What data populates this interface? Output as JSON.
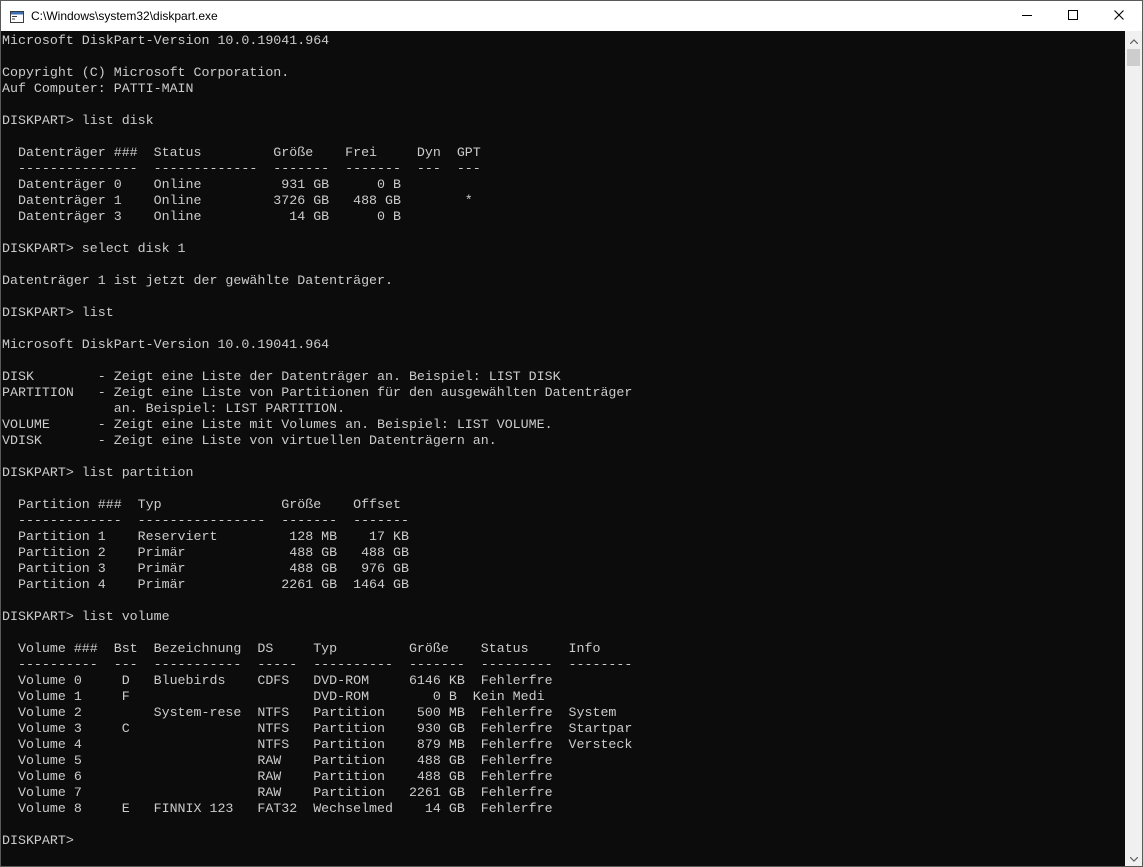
{
  "window": {
    "title": "C:\\Windows\\system32\\diskpart.exe"
  },
  "console": {
    "lines": [
      "Microsoft DiskPart-Version 10.0.19041.964",
      "",
      "Copyright (C) Microsoft Corporation.",
      "Auf Computer: PATTI-MAIN",
      "",
      "DISKPART> list disk",
      "",
      "  Datenträger ###  Status         Größe    Frei     Dyn  GPT",
      "  ---------------  -------------  -------  -------  ---  ---",
      "  Datenträger 0    Online          931 GB      0 B",
      "  Datenträger 1    Online         3726 GB   488 GB        *",
      "  Datenträger 3    Online           14 GB      0 B",
      "",
      "DISKPART> select disk 1",
      "",
      "Datenträger 1 ist jetzt der gewählte Datenträger.",
      "",
      "DISKPART> list",
      "",
      "Microsoft DiskPart-Version 10.0.19041.964",
      "",
      "DISK        - Zeigt eine Liste der Datenträger an. Beispiel: LIST DISK",
      "PARTITION   - Zeigt eine Liste von Partitionen für den ausgewählten Datenträger",
      "              an. Beispiel: LIST PARTITION.",
      "VOLUME      - Zeigt eine Liste mit Volumes an. Beispiel: LIST VOLUME.",
      "VDISK       - Zeigt eine Liste von virtuellen Datenträgern an.",
      "",
      "DISKPART> list partition",
      "",
      "  Partition ###  Typ               Größe    Offset",
      "  -------------  ----------------  -------  -------",
      "  Partition 1    Reserviert         128 MB    17 KB",
      "  Partition 2    Primär             488 GB   488 GB",
      "  Partition 3    Primär             488 GB   976 GB",
      "  Partition 4    Primär            2261 GB  1464 GB",
      "",
      "DISKPART> list volume",
      "",
      "  Volume ###  Bst  Bezeichnung  DS     Typ         Größe    Status     Info",
      "  ----------  ---  -----------  -----  ----------  -------  ---------  --------",
      "  Volume 0     D   Bluebirds    CDFS   DVD-ROM     6146 KB  Fehlerfre",
      "  Volume 1     F                       DVD-ROM        0 B  Kein Medi",
      "  Volume 2         System-rese  NTFS   Partition    500 MB  Fehlerfre  System",
      "  Volume 3     C                NTFS   Partition    930 GB  Fehlerfre  Startpar",
      "  Volume 4                      NTFS   Partition    879 MB  Fehlerfre  Versteck",
      "  Volume 5                      RAW    Partition    488 GB  Fehlerfre",
      "  Volume 6                      RAW    Partition    488 GB  Fehlerfre",
      "  Volume 7                      RAW    Partition   2261 GB  Fehlerfre",
      "  Volume 8     E   FINNIX 123   FAT32  Wechselmed    14 GB  Fehlerfre",
      "",
      "DISKPART>"
    ]
  },
  "icons": {
    "app": "console-icon",
    "minimize": "minimize-icon",
    "maximize": "maximize-icon",
    "close": "close-icon"
  }
}
